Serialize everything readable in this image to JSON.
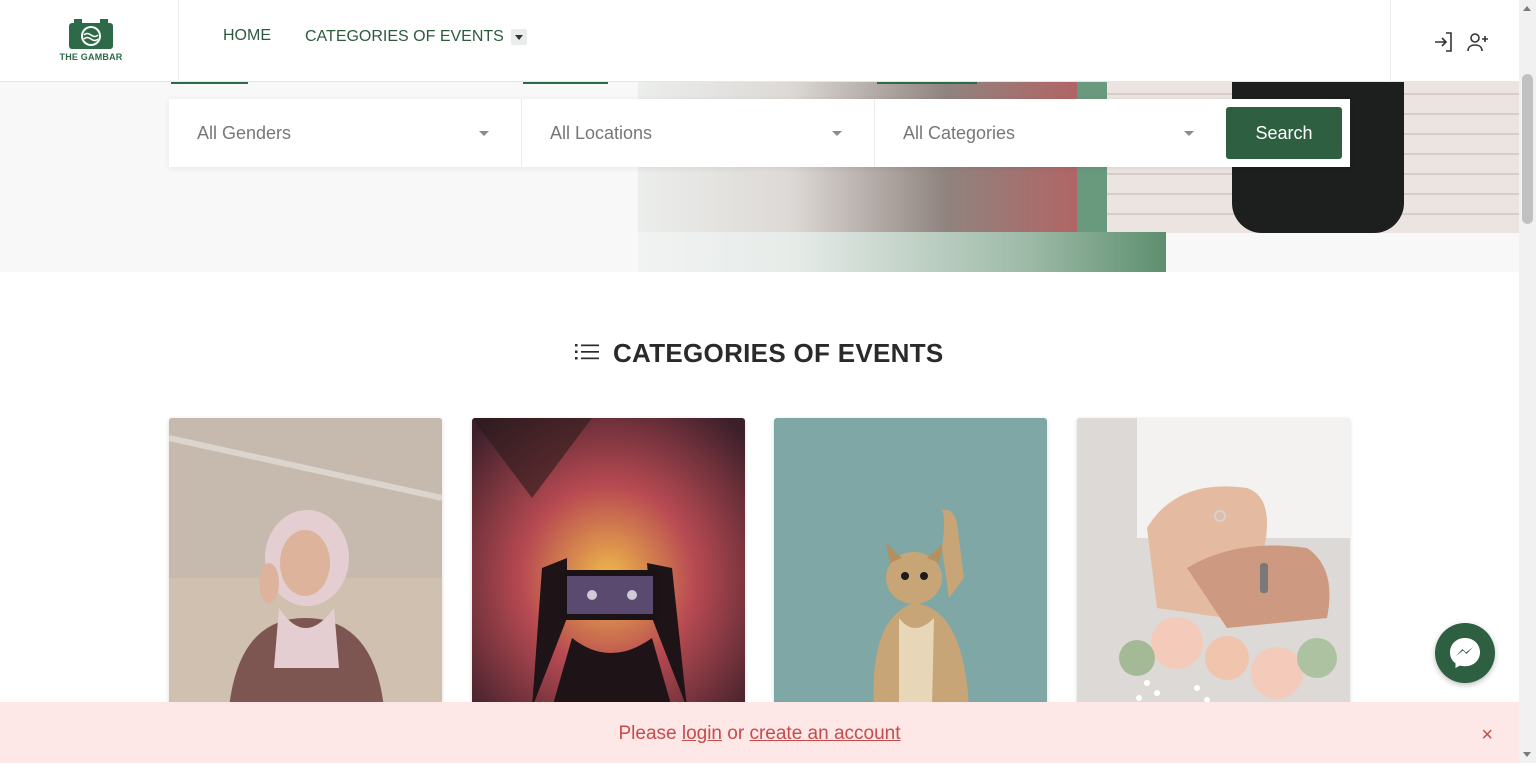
{
  "header": {
    "logo_text": "THE GAMBAR",
    "nav": {
      "home": "HOME",
      "categories": "CATEGORIES OF EVENTS"
    },
    "icons": [
      "login-icon",
      "add-user-icon",
      "chevron-down-icon"
    ]
  },
  "search": {
    "gender": "All Genders",
    "location": "All Locations",
    "category": "All Categories",
    "button": "Search"
  },
  "section": {
    "title": "CATEGORIES OF EVENTS",
    "icon": "list-icon"
  },
  "alert": {
    "prefix": "Please ",
    "login": "login",
    "middle": " or ",
    "create": "create an account",
    "close": "×"
  },
  "colors": {
    "brand": "#2d5f40",
    "alert_bg": "#fde7e7",
    "alert_text": "#c94a4a"
  }
}
